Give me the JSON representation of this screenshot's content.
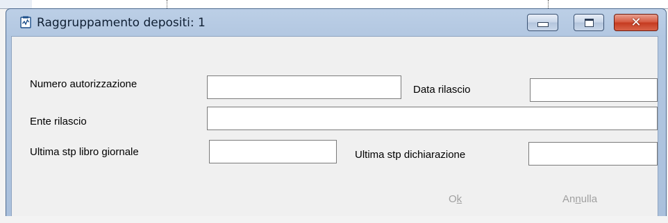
{
  "window": {
    "title": "Raggruppamento depositi: 1",
    "icon": "document-app-icon",
    "controls": [
      "minimize-icon",
      "maximize-icon",
      "close-icon"
    ],
    "close_label": "✕"
  },
  "form": {
    "numero_autorizzazione": {
      "label": "Numero autorizzazione",
      "value": ""
    },
    "data_rilascio": {
      "label": "Data rilascio",
      "value": ""
    },
    "ente_rilascio": {
      "label": "Ente rilascio",
      "value": ""
    },
    "ultima_stp_libro_giornale": {
      "label": "Ultima stp libro giornale",
      "value": ""
    },
    "ultima_stp_dichiarazione": {
      "label": "Ultima stp dichiarazione",
      "value": ""
    }
  },
  "buttons": {
    "ok": {
      "before": "O",
      "mnemonic": "k",
      "after": ""
    },
    "annulla": {
      "before": "An",
      "mnemonic": "n",
      "after": "ulla"
    }
  }
}
